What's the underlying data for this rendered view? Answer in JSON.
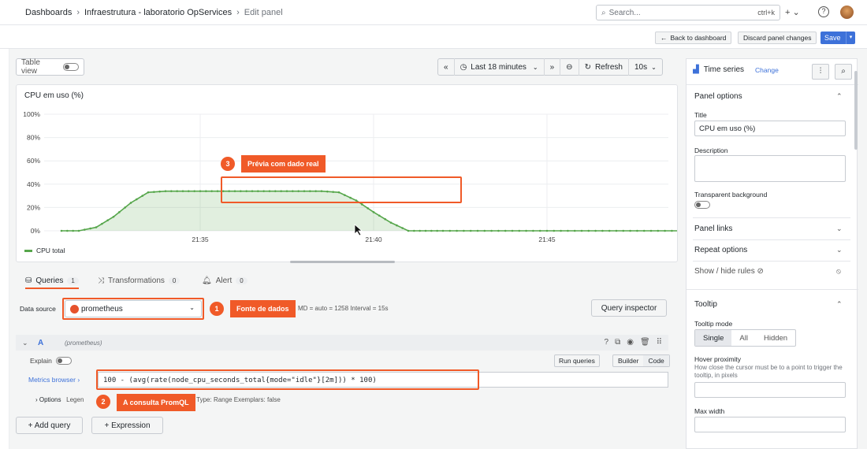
{
  "breadcrumb": {
    "items": [
      "Dashboards",
      "Infraestrutura - laboratorio OpServices",
      "Edit panel"
    ]
  },
  "search": {
    "placeholder": "Search...",
    "shortcut": "ctrl+k"
  },
  "topbar": {
    "add_label": "+ ⌄",
    "help_icon": "?"
  },
  "actions": {
    "back": "Back to dashboard",
    "discard": "Discard panel changes",
    "save": "Save"
  },
  "toolbar": {
    "table_view": "Table view",
    "time_range": "Last 18 minutes",
    "refresh": "Refresh",
    "interval": "10s"
  },
  "panel": {
    "title": "CPU em uso (%)",
    "legend": "CPU total"
  },
  "chart_data": {
    "type": "area",
    "title": "CPU em uso (%)",
    "ylabel": "",
    "ylim": [
      0,
      100
    ],
    "yticks": [
      "100%",
      "80%",
      "60%",
      "40%",
      "20%",
      "0%"
    ],
    "xticks": [
      "21:35",
      "21:40",
      "21:45"
    ],
    "series": [
      {
        "name": "CPU total",
        "color": "#56a64b",
        "x": [
          "21:31:00",
          "21:31:30",
          "21:32:00",
          "21:32:30",
          "21:33:00",
          "21:33:30",
          "21:34:00",
          "21:34:30",
          "21:35:00",
          "21:35:30",
          "21:36:00",
          "21:36:30",
          "21:37:00",
          "21:37:30",
          "21:38:00",
          "21:38:30",
          "21:39:00",
          "21:39:30",
          "21:40:00",
          "21:40:30",
          "21:41:00",
          "21:41:30",
          "21:42:00",
          "21:43:00",
          "21:44:00",
          "21:45:00",
          "21:46:00",
          "21:47:00",
          "21:48:00",
          "21:49:00"
        ],
        "values": [
          0,
          0,
          3,
          12,
          24,
          33,
          34,
          34,
          34,
          34,
          34,
          34,
          34,
          34,
          34,
          34,
          33,
          26,
          16,
          7,
          0,
          0,
          0,
          0,
          0,
          0,
          0,
          0,
          0,
          0
        ]
      }
    ]
  },
  "tabs": {
    "queries": {
      "label": "Queries",
      "count": "1"
    },
    "transformations": {
      "label": "Transformations",
      "count": "0"
    },
    "alert": {
      "label": "Alert",
      "count": "0"
    }
  },
  "datasource": {
    "label": "Data source",
    "value": "prometheus",
    "info": "MD = auto = 1258    Interval = 15s",
    "inspector": "Query inspector"
  },
  "query": {
    "ref": "A",
    "ds": "(prometheus)",
    "explain": "Explain",
    "run": "Run queries",
    "builder": "Builder",
    "code": "Code",
    "metrics_browser": "Metrics browser ›",
    "expr": "100 - (avg(rate(node_cpu_seconds_total{mode=\"idle\"}[2m])) * 100)",
    "options_label": "› Options",
    "options_rest": "Legen",
    "options_tail": "s    Step: auto    Type: Range    Exemplars: false"
  },
  "buttons": {
    "add_query": "+ Add query",
    "expression": "+ Expression"
  },
  "callouts": {
    "c1": {
      "num": "1",
      "text": "Fonte de dados"
    },
    "c2": {
      "num": "2",
      "text": "A consulta PromQL"
    },
    "c3": {
      "num": "3",
      "text": "Prévia com dado real"
    }
  },
  "right_panel": {
    "viz": "Time series",
    "change": "Change",
    "panel_options": "Panel options",
    "title_label": "Title",
    "title_value": "CPU em uso (%)",
    "description_label": "Description",
    "transparent_label": "Transparent background",
    "panel_links": "Panel links",
    "repeat_options": "Repeat options",
    "show_hide": "Show / hide rules",
    "tooltip": "Tooltip",
    "tooltip_mode": "Tooltip mode",
    "modes": [
      "Single",
      "All",
      "Hidden"
    ],
    "hover_label": "Hover proximity",
    "hover_desc": "How close the cursor must be to a point to trigger the tooltip, in pixels",
    "max_width": "Max width"
  }
}
